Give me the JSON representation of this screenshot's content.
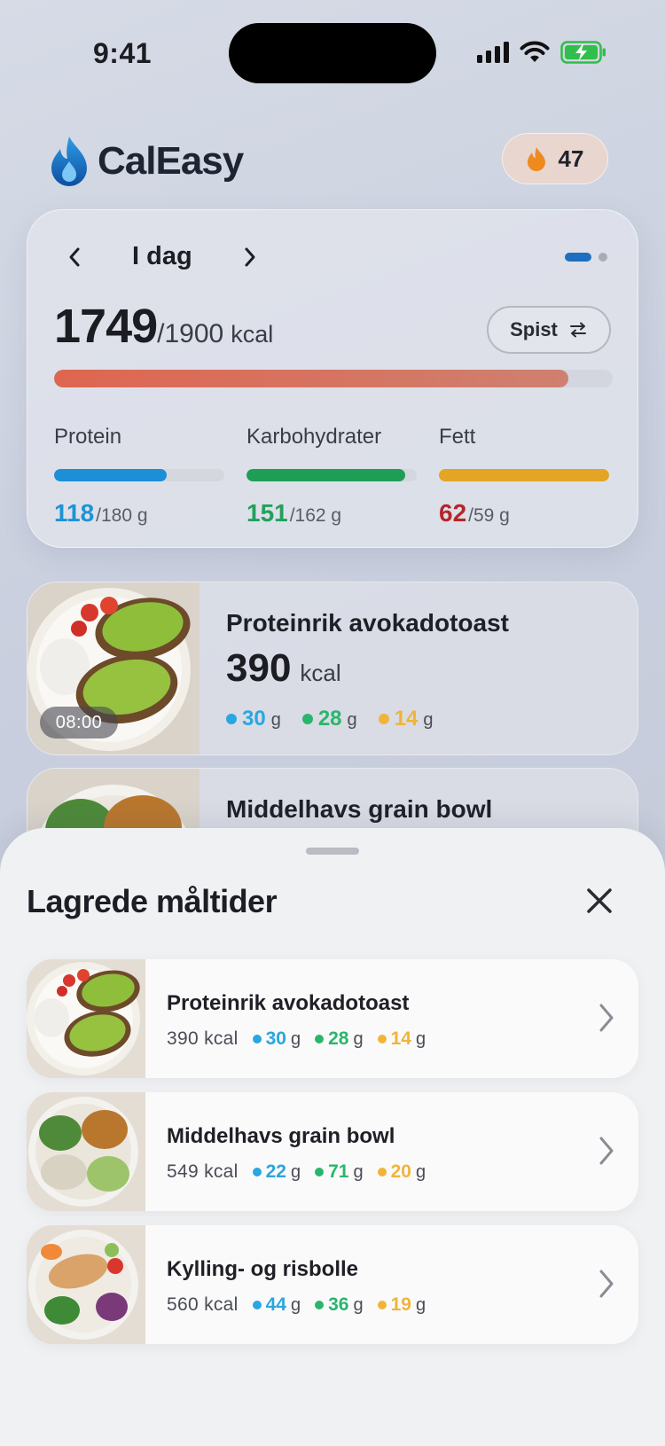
{
  "status": {
    "time": "9:41"
  },
  "header": {
    "app_name": "CalEasy",
    "streak_count": "47"
  },
  "summary": {
    "day_label": "I dag",
    "kcal_eaten": "1749",
    "kcal_goal": "/1900",
    "kcal_unit": "kcal",
    "kcal_progress": 0.92,
    "toggle_label": "Spist",
    "macros": [
      {
        "label": "Protein",
        "value": "118",
        "goal": "/180 g",
        "progress": 0.66,
        "color": "#1c8fd6",
        "value_color": "#1d93d6"
      },
      {
        "label": "Karbohydrater",
        "value": "151",
        "goal": "/162 g",
        "progress": 0.93,
        "color": "#1e9e55",
        "value_color": "#22a15a"
      },
      {
        "label": "Fett",
        "value": "62",
        "goal": "/59 g",
        "progress": 1.0,
        "color": "#e4a524",
        "value_color": "#b5262a"
      }
    ]
  },
  "meals": [
    {
      "title": "Proteinrik avokadotoast",
      "kcal": "390",
      "unit": "kcal",
      "time": "08:00",
      "protein": "30",
      "carbs": "28",
      "fat": "14",
      "g": "g"
    },
    {
      "title": "Middelhavs grain bowl"
    }
  ],
  "sheet": {
    "title": "Lagrede måltider",
    "items": [
      {
        "name": "Proteinrik avokadotoast",
        "kcal": "390 kcal",
        "protein": "30",
        "carbs": "28",
        "fat": "14",
        "g": "g"
      },
      {
        "name": "Middelhavs grain bowl",
        "kcal": "549 kcal",
        "protein": "22",
        "carbs": "71",
        "fat": "20",
        "g": "g"
      },
      {
        "name": "Kylling- og risbolle",
        "kcal": "560 kcal",
        "protein": "44",
        "carbs": "36",
        "fat": "19",
        "g": "g"
      }
    ]
  },
  "colors": {
    "protein": "#2aa6e0",
    "carbs": "#2bb56c",
    "fat": "#f0b43a",
    "accent_blue": "#1d6fc0",
    "calorie_bar": "#de6650"
  },
  "icons": [
    "flame-logo-icon",
    "flame-icon",
    "chevron-left-icon",
    "chevron-right-icon",
    "swap-arrows-icon",
    "close-icon",
    "signal-icon",
    "wifi-icon",
    "battery-icon"
  ]
}
